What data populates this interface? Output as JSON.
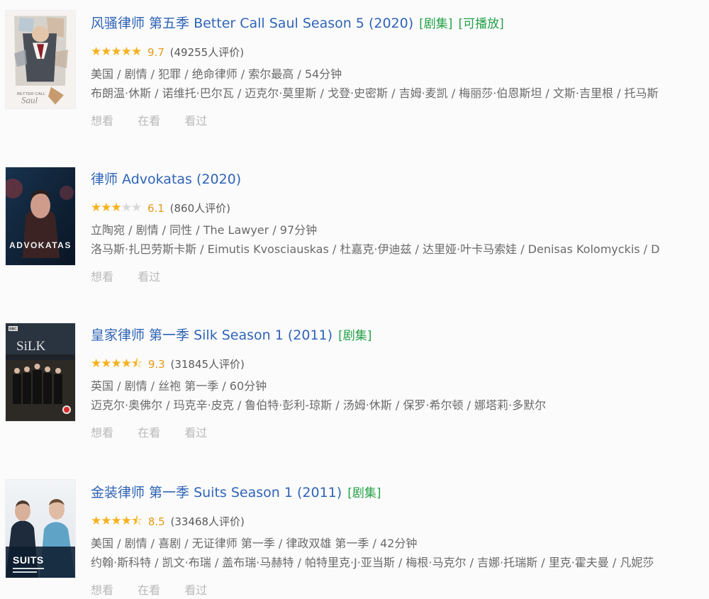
{
  "items": [
    {
      "title": "风骚律师 第五季 Better Call Saul Season 5 (2020)",
      "tags": [
        "[剧集]",
        "[可播放]"
      ],
      "stars_text": "★★★★★",
      "stars_off": "",
      "score": "9.7",
      "votes": "(49255人评价)",
      "meta": "美国 / 剧情 / 犯罪 / 绝命律师 / 索尔最高 / 54分钟",
      "cast": "布朗温·休斯 / 诺维托·巴尔瓦 / 迈克尔·莫里斯 / 戈登·史密斯 / 吉姆·麦凯 / 梅丽莎·伯恩斯坦 / 文斯·吉里根 / 托马斯",
      "actions": [
        "想看",
        "在看",
        "看过"
      ]
    },
    {
      "title": "律师 Advokatas (2020)",
      "tags": [],
      "stars_text": "★★★",
      "stars_off": "★★",
      "score": "6.1",
      "votes": "(860人评价)",
      "meta": "立陶宛 / 剧情 / 同性 / The Lawyer / 97分钟",
      "cast": "洛马斯·扎巴劳斯卡斯 / Eimutis Kvosciauskas / 杜嘉克·伊迪兹 / 达里娅·叶卡马索娃 / Denisas Kolomyckis / D",
      "actions": [
        "想看",
        "看过"
      ]
    },
    {
      "title": "皇家律师 第一季 Silk Season 1 (2011)",
      "tags": [
        "[剧集]"
      ],
      "stars_text": "★★★★⯪",
      "stars_off": "",
      "score": "9.3",
      "votes": "(31845人评价)",
      "meta": "英国 / 剧情 / 丝袍 第一季 / 60分钟",
      "cast": "迈克尔·奥佛尔 / 玛克辛·皮克 / 鲁伯特·彭利-琼斯 / 汤姆·休斯 / 保罗·希尔顿 / 娜塔莉·多默尔",
      "actions": [
        "想看",
        "在看",
        "看过"
      ]
    },
    {
      "title": "金装律师 第一季 Suits Season 1 (2011)",
      "tags": [
        "[剧集]"
      ],
      "stars_text": "★★★★⯪",
      "stars_off": "",
      "score": "8.5",
      "votes": "(33468人评价)",
      "meta": "美国 / 剧情 / 喜剧 / 无证律师 第一季 / 律政双雄 第一季 / 42分钟",
      "cast": "约翰·斯科特 / 凯文·布瑞 / 盖布瑞·马赫特 / 帕特里克·J·亚当斯 / 梅根·马克尔 / 吉娜·托瑞斯 / 里克·霍夫曼 / 凡妮莎",
      "actions": [
        "想看",
        "在看",
        "看过"
      ]
    }
  ],
  "posters": {
    "p0_small_text": "BETTER CALL",
    "p0_logo": "Saul",
    "p1_title": "ADVOKATAS",
    "p2_brand": "BBC",
    "p2_title": "SiLK",
    "p3_title": "SUITS"
  }
}
